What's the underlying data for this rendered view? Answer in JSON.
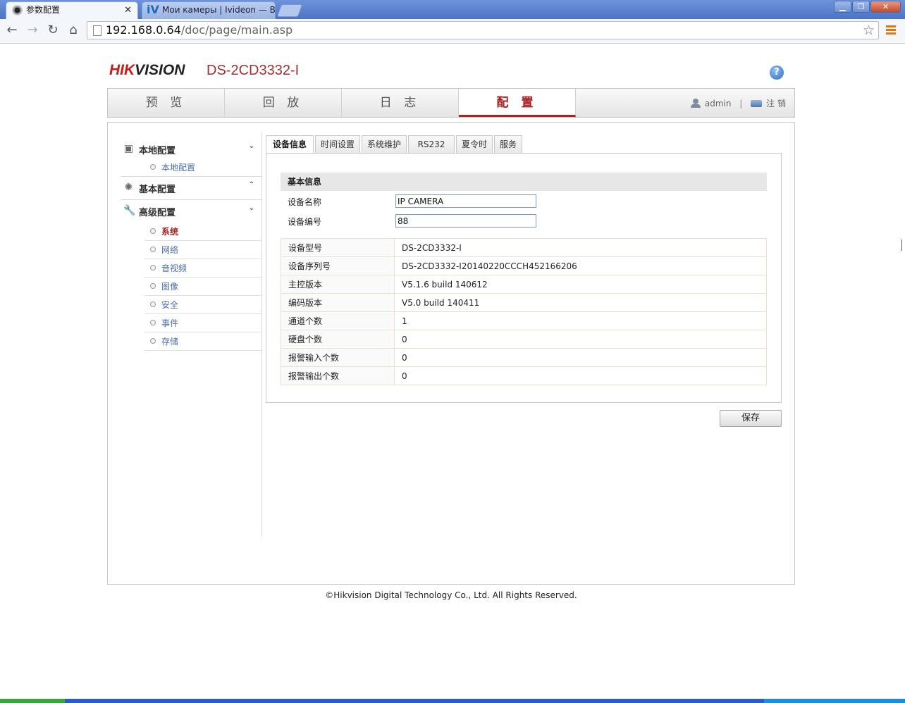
{
  "browser": {
    "tabs": [
      {
        "title": "参数配置",
        "active": true
      },
      {
        "title": "Мои камеры | Ivideon — Ви",
        "active": false
      }
    ],
    "url_host": "192.168.0.64",
    "url_path": "/doc/page/main.asp",
    "window_buttons": {
      "minimize": "▁",
      "maximize": "❐",
      "close": "✕"
    }
  },
  "header": {
    "logo_text_a": "HIK",
    "logo_text_b": "VISION",
    "model": "DS-2CD3332-I",
    "help": "?"
  },
  "main_nav": {
    "tabs": [
      "预 览",
      "回 放",
      "日 志",
      "配 置"
    ],
    "active_index": 3,
    "user": "admin",
    "separator": "|",
    "logout": "注 销"
  },
  "sidebar": {
    "groups": [
      {
        "label": "本地配置",
        "chevron": "⌄",
        "icon": "local-config-icon",
        "items": [
          "本地配置"
        ]
      },
      {
        "label": "基本配置",
        "chevron": "⌃",
        "icon": "gear-icon",
        "items": []
      },
      {
        "label": "高级配置",
        "chevron": "⌄",
        "icon": "wrench-icon",
        "items": [
          "系统",
          "网络",
          "音视频",
          "图像",
          "安全",
          "事件",
          "存储"
        ]
      }
    ],
    "active_item": "系统"
  },
  "sub_tabs": [
    "设备信息",
    "时间设置",
    "系统维护",
    "RS232",
    "夏令时",
    "服务"
  ],
  "device_info": {
    "section_title": "基本信息",
    "name_label": "设备名称",
    "name_value": "IP CAMERA",
    "number_label": "设备编号",
    "number_value": "88",
    "rows": [
      {
        "key": "设备型号",
        "value": "DS-2CD3332-I"
      },
      {
        "key": "设备序列号",
        "value": "DS-2CD3332-I20140220CCCH452166206"
      },
      {
        "key": "主控版本",
        "value": "V5.1.6 build 140612"
      },
      {
        "key": "编码版本",
        "value": "V5.0 build 140411"
      },
      {
        "key": "通道个数",
        "value": "1"
      },
      {
        "key": "硬盘个数",
        "value": "0"
      },
      {
        "key": "报警输入个数",
        "value": "0"
      },
      {
        "key": "报警输出个数",
        "value": "0"
      }
    ]
  },
  "save_label": "保存",
  "footer": "©Hikvision Digital Technology Co., Ltd. All Rights Reserved.",
  "colors": {
    "brand_red": "#c71a1a",
    "active_tab": "#a52020",
    "link_blue": "#4a6ea8"
  }
}
